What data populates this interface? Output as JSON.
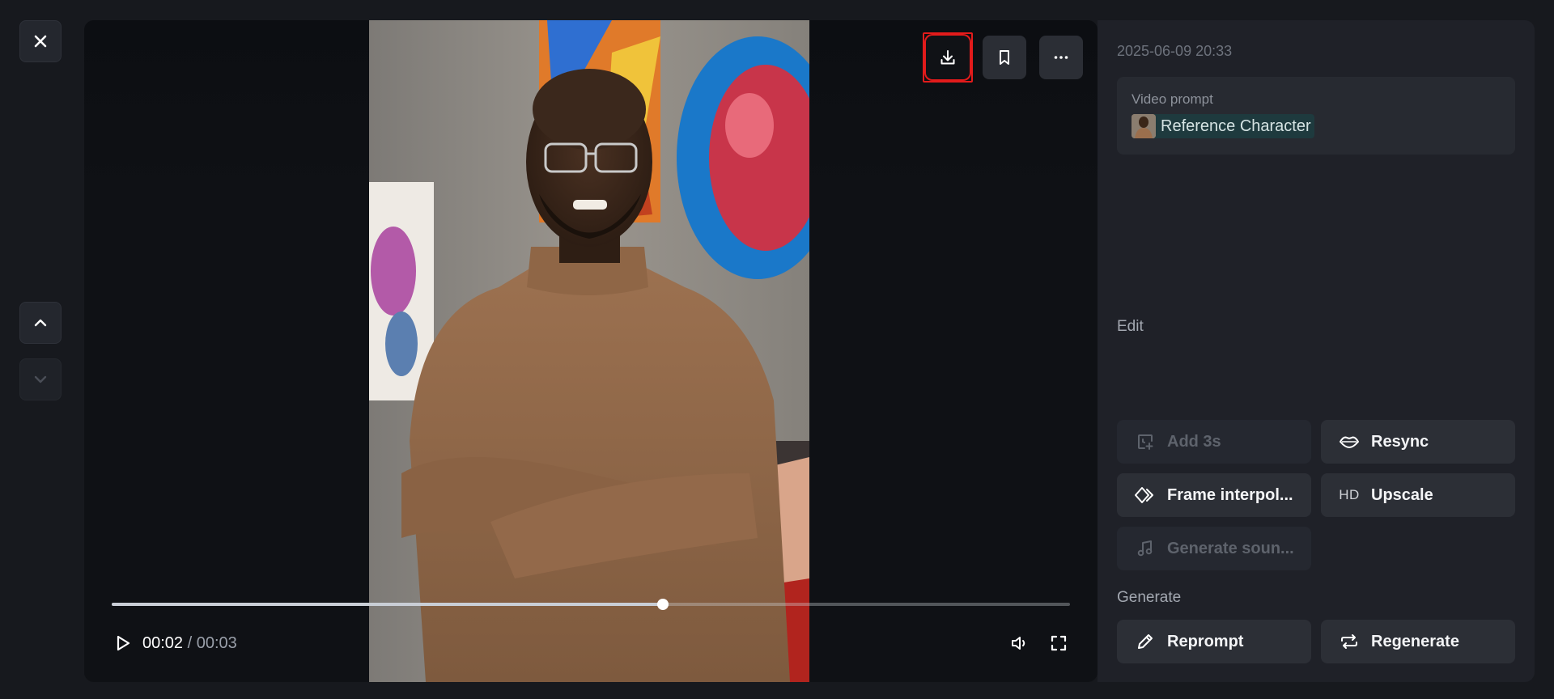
{
  "viewer": {
    "time_current": "00:02",
    "time_separator": "/",
    "time_duration": "00:03",
    "progress_fraction": 0.575
  },
  "panel": {
    "timestamp": "2025-06-09 20:33",
    "prompt_label": "Video prompt",
    "reference_chip": "Reference Character",
    "edit_label": "Edit",
    "generate_label": "Generate",
    "edit_actions": [
      {
        "label": "Add 3s",
        "icon": "clock-plus-icon",
        "disabled": true
      },
      {
        "label": "Resync",
        "icon": "lips-icon",
        "disabled": false
      },
      {
        "label": "Frame interpol...",
        "icon": "diamond-frames-icon",
        "disabled": false
      },
      {
        "label": "Upscale",
        "icon": "hd-icon",
        "icon_text": "HD",
        "disabled": false
      },
      {
        "label": "Generate soun...",
        "icon": "music-note-icon",
        "disabled": true
      }
    ],
    "generate_actions": [
      {
        "label": "Reprompt",
        "icon": "pencil-icon"
      },
      {
        "label": "Regenerate",
        "icon": "repeat-icon"
      }
    ]
  },
  "colors": {
    "background": "#17191e",
    "panel": "#1f2128",
    "highlight": "#e21b1b",
    "chip": "#1e3a3e"
  }
}
